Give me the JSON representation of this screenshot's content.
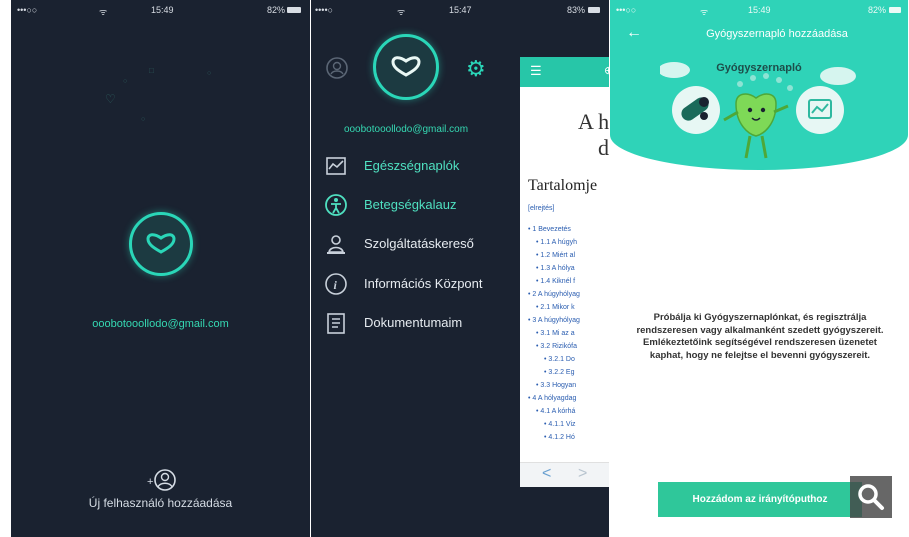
{
  "colors": {
    "accent": "#2fd3b8",
    "dark_bg": "#1a2230",
    "link": "#2a5db0",
    "button": "#2fc79a"
  },
  "screen1": {
    "status": {
      "signal": "•••○○",
      "time": "15:49",
      "battery": "82%"
    },
    "email": "ooobotooollodo@gmail.com",
    "add_user_label": "Új felhasználó hozzáadása",
    "icons": {
      "logo": "heart-logo-icon",
      "add_user": "add-user-icon"
    }
  },
  "screen2": {
    "status": {
      "signal": "••••○",
      "time": "15:47",
      "battery": "83%"
    },
    "email": "ooobotooollodo@gmail.com",
    "menu": [
      {
        "label": "Egészségnaplók",
        "icon": "health-diary-icon"
      },
      {
        "label": "Betegségkalauz",
        "icon": "disease-guide-icon"
      },
      {
        "label": "Szolgáltatáskereső",
        "icon": "service-finder-icon"
      },
      {
        "label": "Információs Központ",
        "icon": "info-center-icon"
      },
      {
        "label": "Dokumentumaim",
        "icon": "documents-icon"
      }
    ],
    "document": {
      "title_line1": "A h",
      "title_line2": "d",
      "toc_title": "Tartalomje",
      "toc_hide": "[elrejtés]",
      "toc": [
        "• 1 Bevezetés",
        "• 1.1 A húgyh",
        "• 1.2 Miért al",
        "• 1.3 A hólya",
        "• 1.4 Kiknél f",
        "• 2 A húgyhólyag",
        "• 2.1 Mikor k",
        "• 3 A húgyhólyag",
        "• 3.1 Mi az a",
        "• 3.2 Rizikófa",
        "• 3.2.1 Do",
        "• 3.2.2 Eg",
        "• 3.3 Hogyan",
        "• 4 A hólyagdag",
        "• 4.1 A kórhá",
        "• 4.1.1 Viz",
        "• 4.1.2 Hó"
      ],
      "nav_prev": "<",
      "nav_next": ">"
    }
  },
  "screen3": {
    "status": {
      "signal": "•••○○",
      "time": "15:49",
      "battery": "82%"
    },
    "header_title": "Gyógyszernapló hozzáadása",
    "illustration_title": "Gyógyszernapló",
    "description": "Próbálja ki Gyógyszernaplónkat, és regisztrálja rendszeresen vagy alkalmanként szedett gyógyszereit. Emlékeztetőink segítségével rendszeresen üzenetet kaphat, hogy ne felejtse el bevenni gyógyszereit.",
    "cta_label": "Hozzádom az irányítóputhoz",
    "icons": {
      "back": "back-arrow-icon",
      "zoom": "search-icon"
    }
  }
}
